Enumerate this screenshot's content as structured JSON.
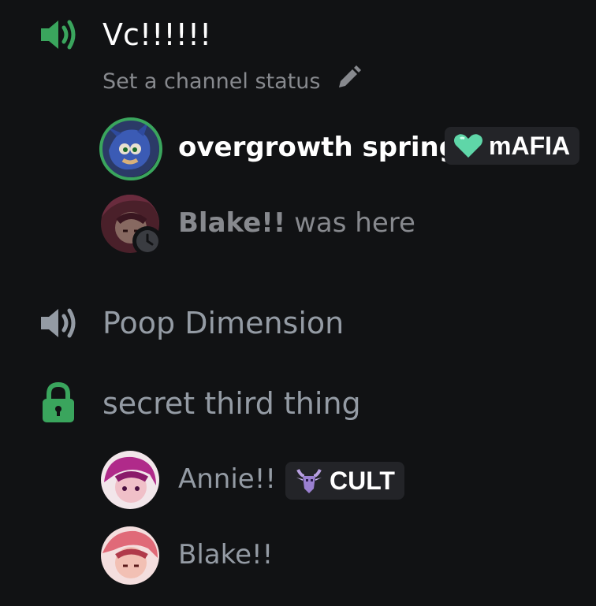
{
  "channels": [
    {
      "name": "Vc!!!!!!",
      "type": "voice",
      "active": true,
      "status_placeholder": "Set a channel status",
      "icon": "speaker-icon"
    },
    {
      "name": "Poop Dimension",
      "type": "voice",
      "active": false,
      "icon": "speaker-icon"
    },
    {
      "name": "secret third thing",
      "type": "voice-locked",
      "active": false,
      "icon": "lock-icon"
    }
  ],
  "users": {
    "overgrowth": {
      "name": "overgrowth spring",
      "tag_icon": "heart-icon",
      "tag_label": "mAFIA",
      "speaking": true
    },
    "blake_idle": {
      "name": "Blake!!",
      "suffix": "was here",
      "status_icon": "clock-icon"
    },
    "annie": {
      "name": "Annie!!",
      "tag_icon": "goat-icon",
      "tag_label": "CULT"
    },
    "blake": {
      "name": "Blake!!"
    }
  },
  "colors": {
    "background": "#111214",
    "accent_green": "#3aa55d",
    "text_bright": "#ffffff",
    "text_muted": "#87898e",
    "text_channel": "#949ba4",
    "tag_bg": "#232428"
  }
}
